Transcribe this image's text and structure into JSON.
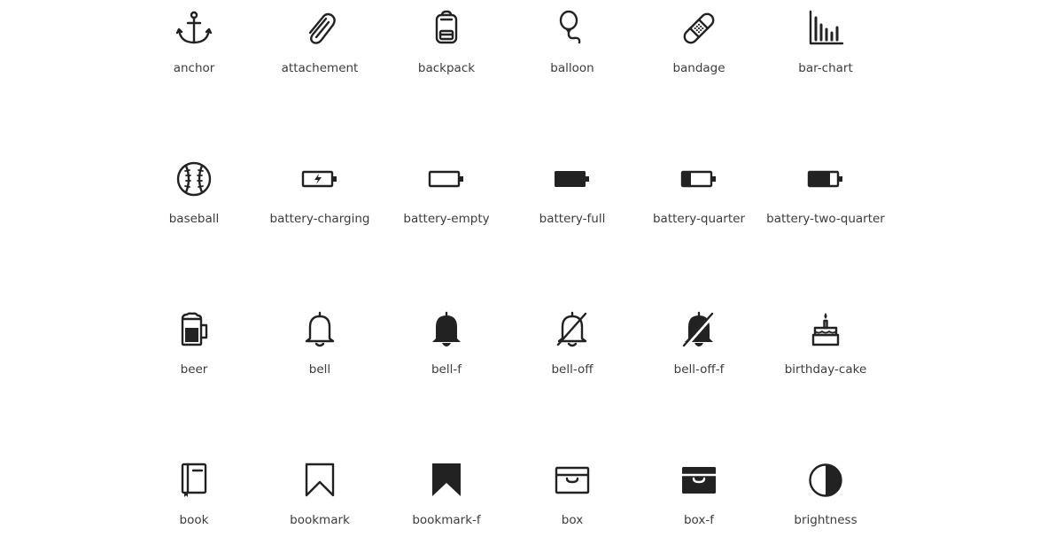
{
  "icons": [
    {
      "label": "anchor",
      "icon": "anchor-icon"
    },
    {
      "label": "attachement",
      "icon": "paperclip-icon"
    },
    {
      "label": "backpack",
      "icon": "backpack-icon"
    },
    {
      "label": "balloon",
      "icon": "balloon-icon"
    },
    {
      "label": "bandage",
      "icon": "bandage-icon"
    },
    {
      "label": "bar-chart",
      "icon": "bar-chart-icon"
    },
    {
      "label": "baseball",
      "icon": "baseball-icon"
    },
    {
      "label": "battery-charging",
      "icon": "battery-charging-icon"
    },
    {
      "label": "battery-empty",
      "icon": "battery-empty-icon"
    },
    {
      "label": "battery-full",
      "icon": "battery-full-icon"
    },
    {
      "label": "battery-quarter",
      "icon": "battery-quarter-icon"
    },
    {
      "label": "battery-two-quarter",
      "icon": "battery-two-quarter-icon"
    },
    {
      "label": "beer",
      "icon": "beer-icon"
    },
    {
      "label": "bell",
      "icon": "bell-icon"
    },
    {
      "label": "bell-f",
      "icon": "bell-filled-icon"
    },
    {
      "label": "bell-off",
      "icon": "bell-off-icon"
    },
    {
      "label": "bell-off-f",
      "icon": "bell-off-filled-icon"
    },
    {
      "label": "birthday-cake",
      "icon": "birthday-cake-icon"
    },
    {
      "label": "book",
      "icon": "book-icon"
    },
    {
      "label": "bookmark",
      "icon": "bookmark-icon"
    },
    {
      "label": "bookmark-f",
      "icon": "bookmark-filled-icon"
    },
    {
      "label": "box",
      "icon": "box-icon"
    },
    {
      "label": "box-f",
      "icon": "box-filled-icon"
    },
    {
      "label": "brightness",
      "icon": "brightness-icon"
    }
  ],
  "colors": {
    "icon": "#222222",
    "label": "#3c3c3c",
    "background": "#ffffff"
  }
}
